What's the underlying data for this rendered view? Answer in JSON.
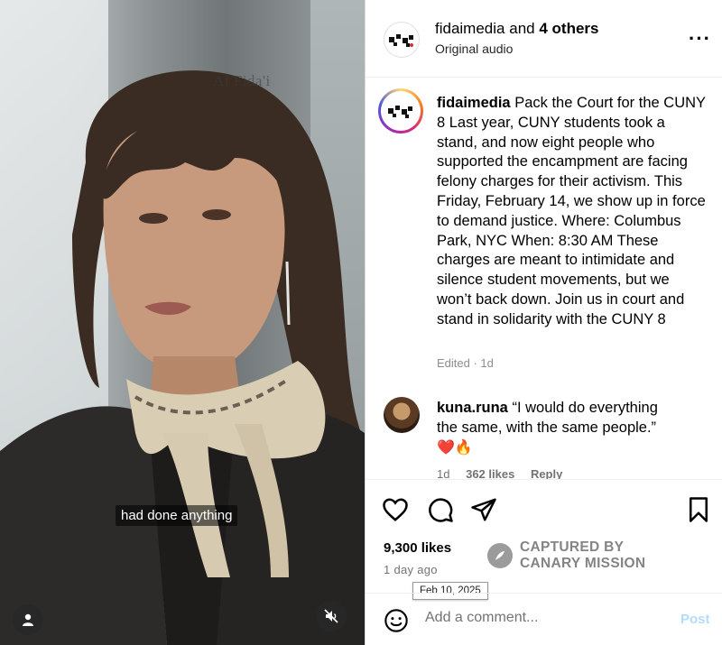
{
  "video": {
    "watermark": "Al Fida'i",
    "subtitle": "had done anything",
    "icons": {
      "user": "user-icon",
      "mute": "muted-speaker-icon"
    }
  },
  "header": {
    "username": "fidaimedia",
    "and_text": "and",
    "others": "4 others",
    "audio": "Original audio",
    "more_icon": "more-options-icon"
  },
  "caption": {
    "username": "fidaimedia",
    "text": "Pack the Court for the CUNY 8   Last year, CUNY students took a stand, and now eight people who supported the encampment are facing felony charges for their activism.   This Friday, February 14, we show up in force to demand justice.   Where: Columbus Park, NYC When: 8:30 AM   These charges are meant to intimidate and silence student movements, but we won’t back down.   Join us in court and stand in solidarity with the CUNY 8",
    "edited": "Edited · 1d"
  },
  "comment": {
    "username": "kuna.runa",
    "text": "“I would do everything the same, with the same people.”",
    "emoji": "❤️🔥",
    "age": "1d",
    "likes": "362 likes",
    "reply": "Reply"
  },
  "actions": {
    "icons": [
      "heart-icon",
      "comment-icon",
      "share-icon",
      "bookmark-icon"
    ],
    "likes": "9,300 likes",
    "ago": "1 day ago",
    "tooltip": "Feb 10, 2025",
    "captured_line1": "CAPTURED BY",
    "captured_line2": "CANARY MISSION"
  },
  "comment_bar": {
    "placeholder": "Add a comment...",
    "post": "Post"
  },
  "colors": {
    "post_disabled": "#b3dbff",
    "meta": "#737373",
    "accent_ring": "#d62976"
  }
}
